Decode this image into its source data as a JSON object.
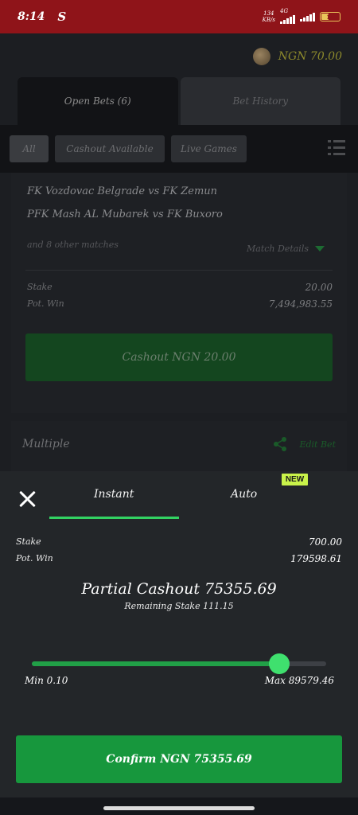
{
  "status_bar": {
    "time": "8:14",
    "app_icon_letter": "S",
    "net_speed_value": "134",
    "net_speed_unit": "KB/s",
    "network": "4G",
    "battery_level": "14"
  },
  "header": {
    "balance": "NGN 70.00",
    "avatar_icon": "profile-avatar"
  },
  "bet_tabs": [
    {
      "label": "Open Bets (6)",
      "active": true
    },
    {
      "label": "Bet History",
      "active": false
    }
  ],
  "filters": [
    {
      "label": "All",
      "active": true
    },
    {
      "label": "Cashout Available",
      "active": false
    },
    {
      "label": "Live Games",
      "active": false
    }
  ],
  "bet_card": {
    "matches": [
      "FK Vozdovac Belgrade vs FK Zemun",
      "PFK Mash AL Mubarek vs FK Buxoro"
    ],
    "other_matches": "and 8 other matches",
    "details_label": "Match Details",
    "stake_label": "Stake",
    "stake_value": "20.00",
    "pot_win_label": "Pot. Win",
    "pot_win_value": "7,494,983.55",
    "cashout_button": "Cashout NGN 20.00"
  },
  "second_card": {
    "title": "Multiple",
    "edit_label": "Edit Bet"
  },
  "cashout_sheet": {
    "tabs": [
      {
        "label": "Instant",
        "active": true
      },
      {
        "label": "Auto",
        "active": false
      }
    ],
    "new_badge": "NEW",
    "stake_label": "Stake",
    "stake_value": "700.00",
    "pot_win_label": "Pot. Win",
    "pot_win_value": "179598.61",
    "partial_cashout": "Partial Cashout 75355.69",
    "remaining_stake": "Remaining Stake 111.15",
    "slider": {
      "min_label": "Min 0.10",
      "max_label": "Max 89579.46",
      "level_fraction": 0.841
    },
    "confirm_button": "Confirm NGN 75355.69"
  },
  "colors": {
    "accent_green": "#32d262",
    "confirm_green": "#17973d",
    "status_bar_red": "#8f1419",
    "badge_yellow": "#c9f34a"
  }
}
